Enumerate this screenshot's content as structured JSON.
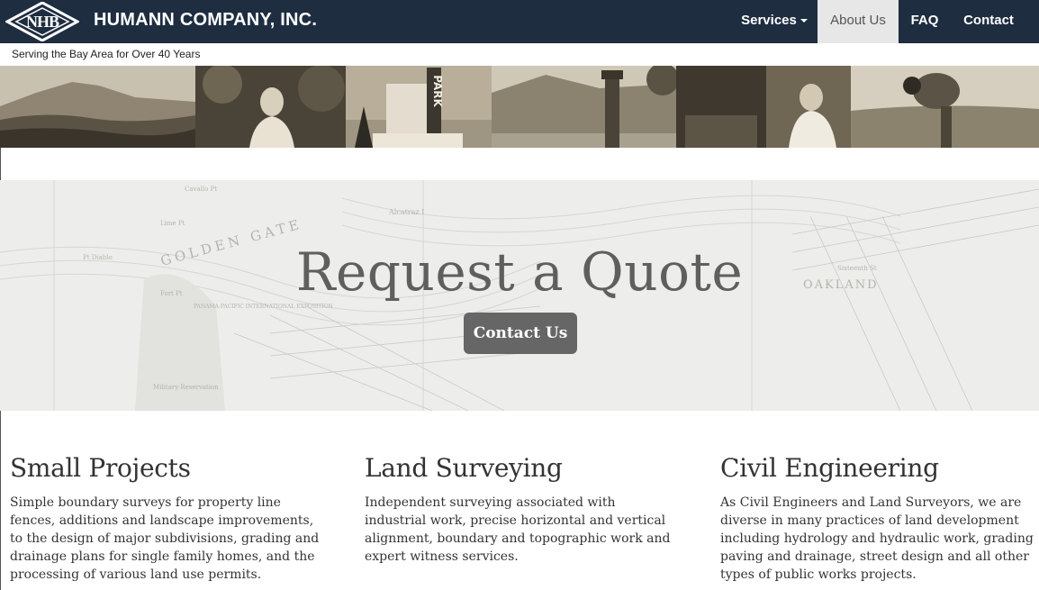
{
  "brand": {
    "name": "HUMANN COMPANY, INC.",
    "tagline": "Serving the Bay Area for Over 40 Years",
    "logo_letters": "NHB"
  },
  "nav": {
    "items": [
      {
        "label": "Services",
        "dropdown": true
      },
      {
        "label": "About Us",
        "active": true
      },
      {
        "label": "FAQ"
      },
      {
        "label": "Contact"
      }
    ]
  },
  "hero": {
    "title": "Request a Quote",
    "button": "Contact Us"
  },
  "columns": [
    {
      "heading": "Small Projects",
      "body": "Simple boundary surveys for property line fences, additions and landscape improvements, to the design of major subdivisions, grading and drainage plans for single family homes, and the processing of various land use permits."
    },
    {
      "heading": "Land Surveying",
      "body": "Independent surveying associated with industrial work, precise horizontal and vertical alignment, boundary and topographic work and expert witness services."
    },
    {
      "heading": "Civil Engineering",
      "body": "As Civil Engineers and Land Surveyors, we are diverse in many practices of land development including hydrology and hydraulic work, grading paving and drainage, street design and all other types of public works projects."
    }
  ],
  "map_labels": [
    "GOLDEN GATE",
    "OAKLAND",
    "Alcatraz I",
    "PANAMA-PACIFIC INTERNATIONAL EXPOSITION",
    "Fort Pt",
    "Sixteenth St",
    "Military Reservation",
    "Pt Diablo",
    "Lime Pt",
    "Cavallo Pt"
  ],
  "photo_sign": "PARK",
  "colors": {
    "navbar": "#1e2d40",
    "active_nav_bg": "#e7e7e7",
    "hero_button": "#666666",
    "sepia": "#8a7a62"
  }
}
